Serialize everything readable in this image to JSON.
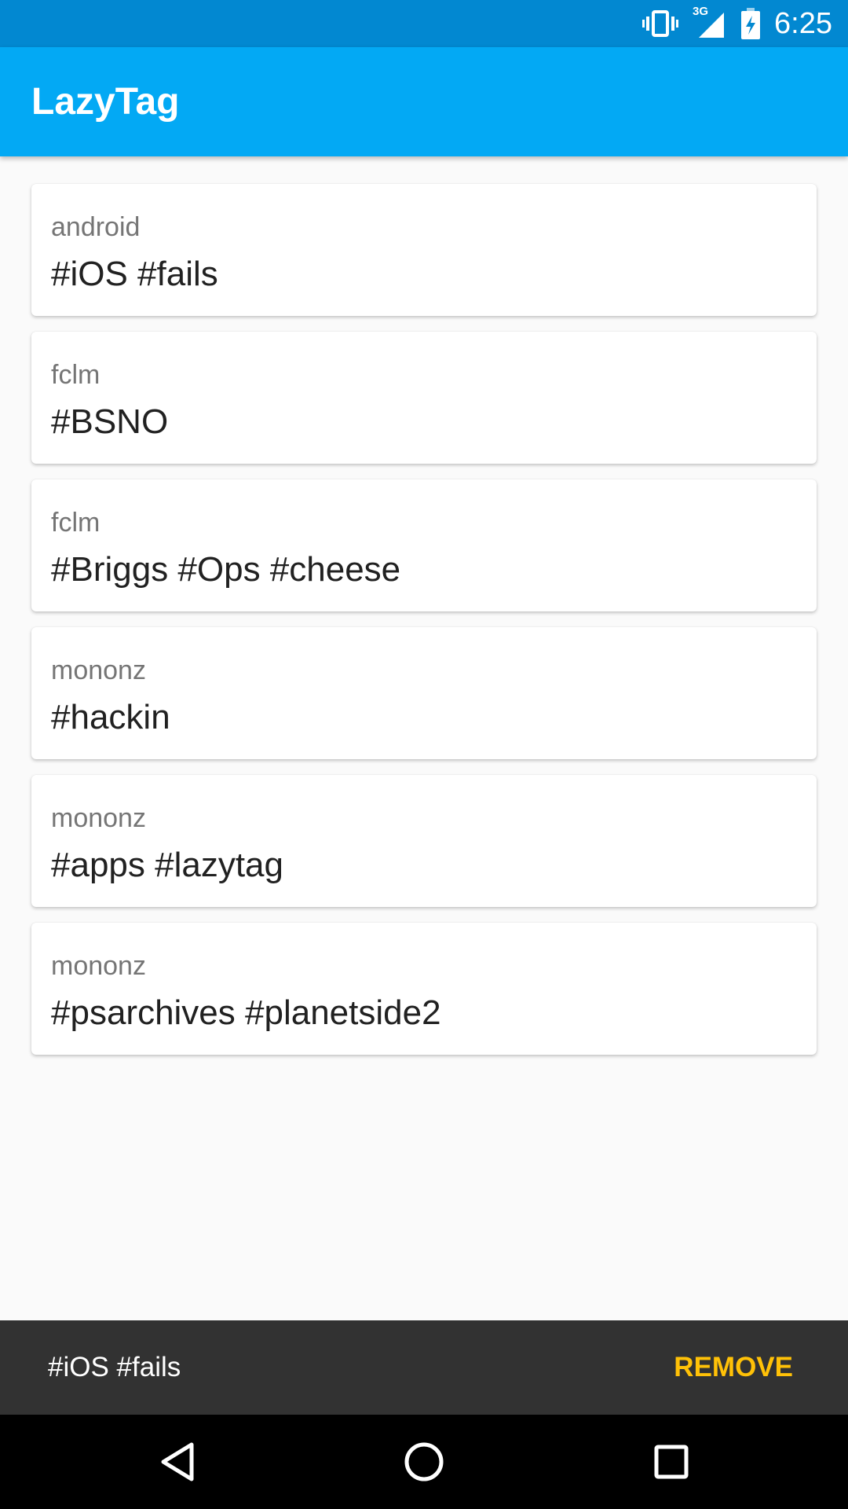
{
  "status_bar": {
    "time": "6:25",
    "network_type": "3G",
    "icons": [
      "vibrate-icon",
      "cell-signal-icon",
      "battery-charging-icon"
    ]
  },
  "app_bar": {
    "title": "LazyTag",
    "color": "#03a9f4"
  },
  "cards": [
    {
      "user": "android",
      "tags": "#iOS #fails"
    },
    {
      "user": "fclm",
      "tags": "#BSNO"
    },
    {
      "user": "fclm",
      "tags": "#Briggs #Ops #cheese"
    },
    {
      "user": "mononz",
      "tags": "#hackin"
    },
    {
      "user": "mononz",
      "tags": "#apps #lazytag"
    },
    {
      "user": "mononz",
      "tags": "#psarchives #planetside2"
    }
  ],
  "snackbar": {
    "message": "#iOS #fails",
    "action": "REMOVE",
    "action_color": "#ffc107"
  },
  "nav_bar": {
    "icons": [
      "back-triangle-icon",
      "home-circle-icon",
      "recents-square-icon"
    ]
  }
}
